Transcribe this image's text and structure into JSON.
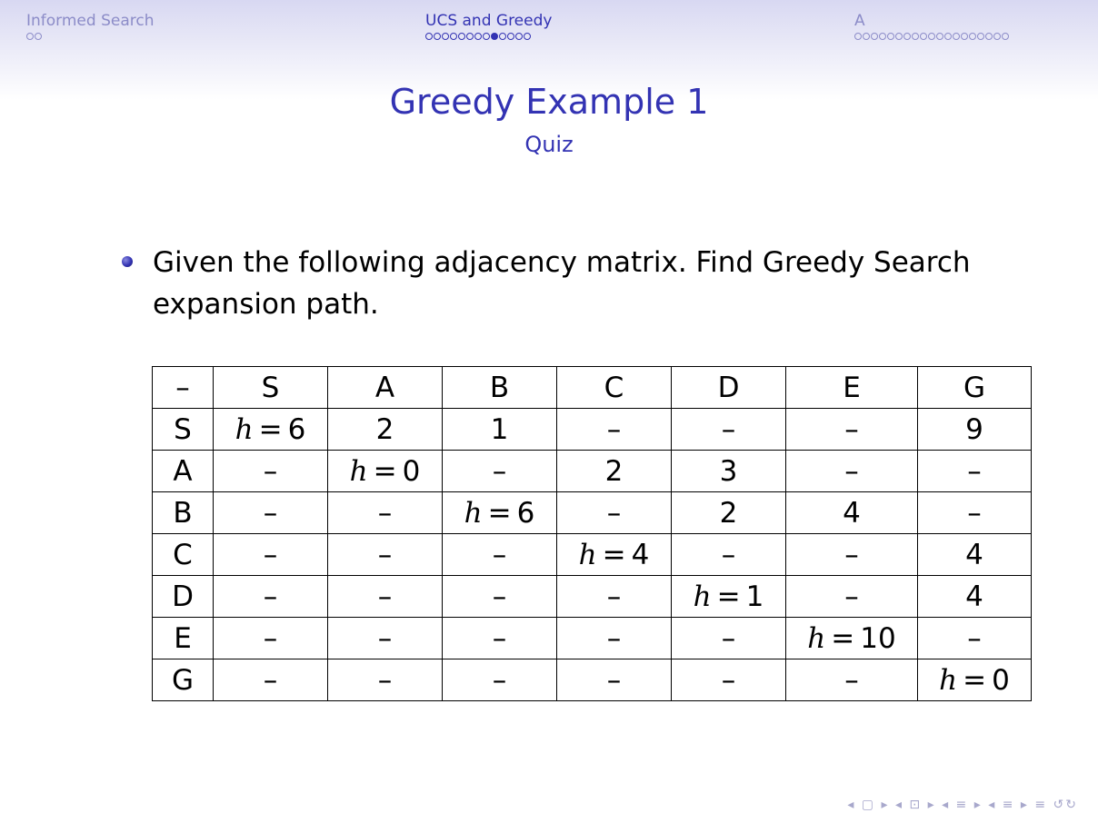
{
  "nav": {
    "sections": [
      {
        "title": "Informed Search",
        "dots": 2,
        "filled_index": -1,
        "active": false
      },
      {
        "title": "UCS and Greedy",
        "dots": 13,
        "filled_index": 8,
        "active": true
      },
      {
        "title": "A",
        "dots": 19,
        "filled_index": -1,
        "active": false
      }
    ]
  },
  "frame": {
    "title": "Greedy Example 1",
    "subtitle": "Quiz"
  },
  "bullet": {
    "text": "Given the following adjacency matrix. Find Greedy Search expansion path."
  },
  "table": {
    "header": [
      "–",
      "S",
      "A",
      "B",
      "C",
      "D",
      "E",
      "G"
    ],
    "rows": [
      [
        "S",
        "h = 6",
        "2",
        "1",
        "–",
        "–",
        "–",
        "9"
      ],
      [
        "A",
        "–",
        "h = 0",
        "–",
        "2",
        "3",
        "–",
        "–"
      ],
      [
        "B",
        "–",
        "–",
        "h = 6",
        "–",
        "2",
        "4",
        "–"
      ],
      [
        "C",
        "–",
        "–",
        "–",
        "h = 4",
        "–",
        "–",
        "4"
      ],
      [
        "D",
        "–",
        "–",
        "–",
        "–",
        "h = 1",
        "–",
        "4"
      ],
      [
        "E",
        "–",
        "–",
        "–",
        "–",
        "–",
        "h = 10",
        "–"
      ],
      [
        "G",
        "–",
        "–",
        "–",
        "–",
        "–",
        "–",
        "h = 0"
      ]
    ]
  },
  "colors": {
    "accent": "#3333b3",
    "inactive": "#8c8cc8"
  },
  "footer": {
    "icons": "◂ ▢ ▸ ◂ ⊡ ▸ ◂ ≡ ▸ ◂ ≡ ▸ ≡ ↺↻"
  }
}
